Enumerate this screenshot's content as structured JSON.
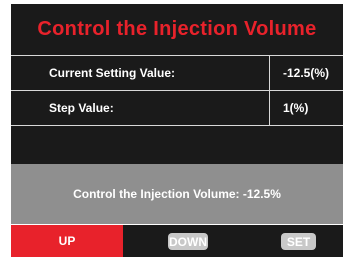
{
  "header": {
    "title": "Control the Injection Volume"
  },
  "settings": [
    {
      "label": "Current Setting Value:",
      "value": "-12.5(%)"
    },
    {
      "label": "Step Value:",
      "value": "1(%)"
    }
  ],
  "status": {
    "text": "Control the Injection Volume: -12.5%"
  },
  "buttons": {
    "up": "UP",
    "down": "DOWN",
    "set": "SET"
  },
  "colors": {
    "accent": "#e8222b",
    "panel": "#1a1a1a",
    "status_bar": "#8f8f8f",
    "button_inactive": "#c8c8c8"
  }
}
